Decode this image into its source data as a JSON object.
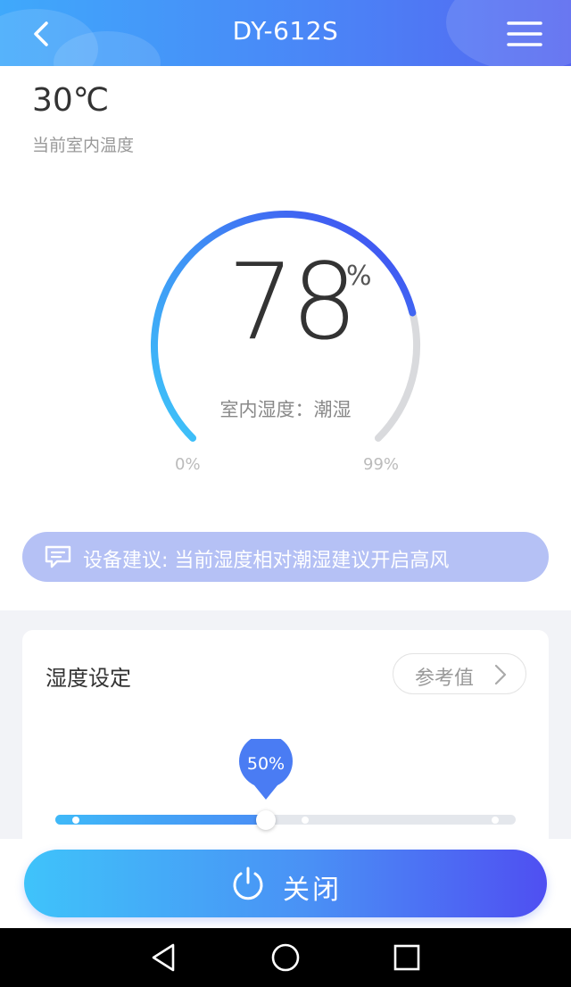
{
  "header": {
    "title": "DY-612S",
    "back_icon": "chevron-left-icon",
    "menu_icon": "hamburger-menu-icon",
    "gradient": [
      "#3fa9fb",
      "#5565f0"
    ]
  },
  "indoor": {
    "temperature": "30℃",
    "temperature_label": "当前室内温度"
  },
  "gauge": {
    "value": "78",
    "unit": "%",
    "status": "室内湿度：潮湿",
    "min_label": "0%",
    "max_label": "99%",
    "level_percent": 78,
    "colors": {
      "start": "#3ec6f9",
      "end": "#4044f0",
      "track": "#d9dadd"
    }
  },
  "advice": {
    "icon": "message-icon",
    "text": "设备建议: 当前湿度相对潮湿建议开启高风",
    "color": "#b5c1f5"
  },
  "humidity_setting": {
    "title": "湿度设定",
    "reference_button": "参考值",
    "value_label": "50%",
    "value_percent": 50,
    "accent": "#4a7cf3"
  },
  "power_button": {
    "label": "关闭",
    "icon": "power-icon"
  },
  "system_nav": {
    "back_icon": "triangle-back-icon",
    "home_icon": "circle-home-icon",
    "recents_icon": "square-recents-icon"
  }
}
